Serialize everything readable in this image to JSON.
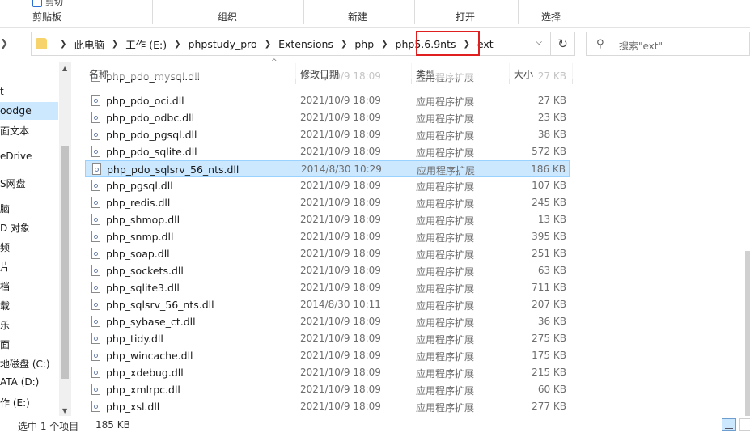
{
  "ribbon": {
    "top_cut_label": "剪切",
    "groups": [
      "剪贴板",
      "组织",
      "新建",
      "打开",
      "选择"
    ]
  },
  "address": {
    "crumbs": [
      "此电脑",
      "工作 (E:)",
      "phpstudy_pro",
      "Extensions",
      "php",
      "php5.6.9nts",
      "ext"
    ],
    "search_placeholder": "搜索\"ext\""
  },
  "nav_pane": [
    "t",
    "oodge",
    "面文本",
    "eDrive",
    "S网盘",
    "脑",
    "D 对象",
    "频",
    "片",
    "档",
    "载",
    "乐",
    "面",
    "地磁盘 (C:)",
    "ATA (D:)",
    "作 (E:)"
  ],
  "columns": {
    "name": "名称",
    "date": "修改日期",
    "type": "类型",
    "size": "大小"
  },
  "files": [
    {
      "name": "php_pdo_mysql.dll",
      "date": "2021/10/9 18:09",
      "type": "应用程序扩展",
      "size": "27 KB"
    },
    {
      "name": "php_pdo_oci.dll",
      "date": "2021/10/9 18:09",
      "type": "应用程序扩展",
      "size": "27 KB"
    },
    {
      "name": "php_pdo_odbc.dll",
      "date": "2021/10/9 18:09",
      "type": "应用程序扩展",
      "size": "23 KB"
    },
    {
      "name": "php_pdo_pgsql.dll",
      "date": "2021/10/9 18:09",
      "type": "应用程序扩展",
      "size": "38 KB"
    },
    {
      "name": "php_pdo_sqlite.dll",
      "date": "2021/10/9 18:09",
      "type": "应用程序扩展",
      "size": "572 KB"
    },
    {
      "name": "php_pdo_sqlsrv_56_nts.dll",
      "date": "2014/8/30 10:29",
      "type": "应用程序扩展",
      "size": "186 KB",
      "selected": true
    },
    {
      "name": "php_pgsql.dll",
      "date": "2021/10/9 18:09",
      "type": "应用程序扩展",
      "size": "107 KB"
    },
    {
      "name": "php_redis.dll",
      "date": "2021/10/9 18:09",
      "type": "应用程序扩展",
      "size": "245 KB"
    },
    {
      "name": "php_shmop.dll",
      "date": "2021/10/9 18:09",
      "type": "应用程序扩展",
      "size": "13 KB"
    },
    {
      "name": "php_snmp.dll",
      "date": "2021/10/9 18:09",
      "type": "应用程序扩展",
      "size": "395 KB"
    },
    {
      "name": "php_soap.dll",
      "date": "2021/10/9 18:09",
      "type": "应用程序扩展",
      "size": "251 KB"
    },
    {
      "name": "php_sockets.dll",
      "date": "2021/10/9 18:09",
      "type": "应用程序扩展",
      "size": "63 KB"
    },
    {
      "name": "php_sqlite3.dll",
      "date": "2021/10/9 18:09",
      "type": "应用程序扩展",
      "size": "711 KB"
    },
    {
      "name": "php_sqlsrv_56_nts.dll",
      "date": "2014/8/30 10:11",
      "type": "应用程序扩展",
      "size": "207 KB"
    },
    {
      "name": "php_sybase_ct.dll",
      "date": "2021/10/9 18:09",
      "type": "应用程序扩展",
      "size": "36 KB"
    },
    {
      "name": "php_tidy.dll",
      "date": "2021/10/9 18:09",
      "type": "应用程序扩展",
      "size": "275 KB"
    },
    {
      "name": "php_wincache.dll",
      "date": "2021/10/9 18:09",
      "type": "应用程序扩展",
      "size": "175 KB"
    },
    {
      "name": "php_xdebug.dll",
      "date": "2021/10/9 18:09",
      "type": "应用程序扩展",
      "size": "215 KB"
    },
    {
      "name": "php_xmlrpc.dll",
      "date": "2021/10/9 18:09",
      "type": "应用程序扩展",
      "size": "60 KB"
    },
    {
      "name": "php_xsl.dll",
      "date": "2021/10/9 18:09",
      "type": "应用程序扩展",
      "size": "277 KB"
    }
  ],
  "status": {
    "selected_text": "选中 1 个项目",
    "selected_size": "185 KB"
  },
  "colors": {
    "selection_bg": "#cce8ff",
    "selection_border": "#99d1ff",
    "annotation_red": "#e02020",
    "folder_yellow": "#f7d36b"
  },
  "icons": [
    "folder-icon",
    "refresh-icon",
    "search-icon",
    "dll-file-icon",
    "details-view-icon",
    "large-icons-view-icon"
  ]
}
